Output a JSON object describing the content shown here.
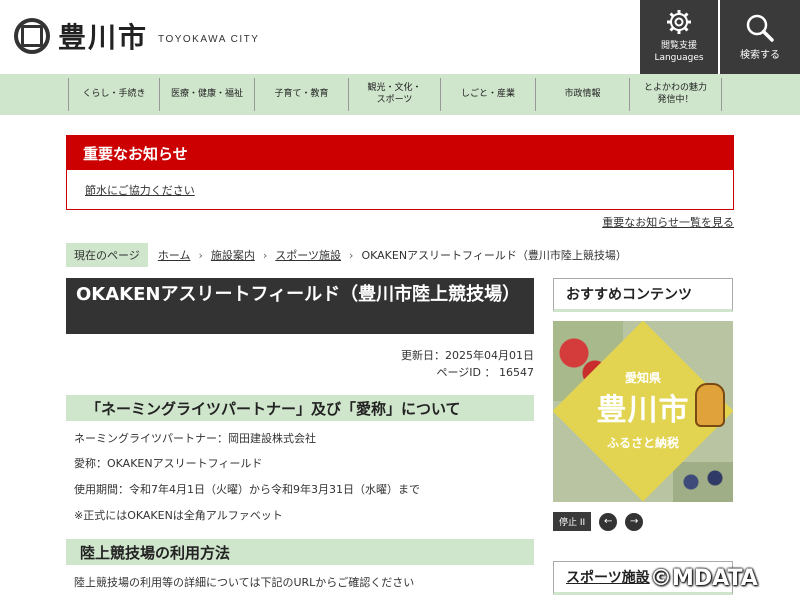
{
  "header": {
    "logo_jp": "豊川市",
    "logo_en": "TOYOKAWA CITY",
    "support_label_1": "閲覧支援",
    "support_label_2": "Languages",
    "search_label": "検索する"
  },
  "nav": {
    "items": [
      {
        "label": "くらし・手続き"
      },
      {
        "label": "医療・健康・福祉"
      },
      {
        "label": "子育て・教育"
      },
      {
        "label_1": "観光・文化・",
        "label_2": "スポーツ"
      },
      {
        "label": "しごと・産業"
      },
      {
        "label": "市政情報"
      },
      {
        "label_1": "とよかわの魅力",
        "label_2": "発信中！"
      }
    ]
  },
  "notice": {
    "heading": "重要なお知らせ",
    "link": "節水にご協力ください",
    "all_link": "重要なお知らせ一覧を見る"
  },
  "breadcrumb": {
    "label": "現在のページ",
    "items": [
      "ホーム",
      "施設案内",
      "スポーツ施設",
      "OKAKENアスリートフィールド（豊川市陸上競技場）"
    ]
  },
  "main": {
    "title": "OKAKENアスリートフィールド（豊川市陸上競技場）",
    "updated": "更新日：2025年04月01日",
    "page_id": "ページID ： 16547",
    "section1": {
      "heading": "「ネーミングライツパートナー」及び「愛称」について",
      "lines": [
        "ネーミングライツパートナー：岡田建設株式会社",
        "愛称：OKAKENアスリートフィールド",
        "使用期間：令和7年4月1日（火曜）から令和9年3月31日（水曜）まで",
        "※正式にはOKAKENは全角アルファベット"
      ]
    },
    "section2": {
      "heading": "陸上競技場の利用方法",
      "line": "陸上競技場の利用等の詳細については下記のURLからご確認ください"
    }
  },
  "sidebar": {
    "recommended": "おすすめコンテンツ",
    "banner": {
      "pref": "愛知県",
      "city": "豊川市",
      "tax": "ふるさと納税"
    },
    "stop_label": "停止 II",
    "prev": "←",
    "next": "→",
    "sports": "スポーツ施設"
  },
  "watermark": "©MDATA"
}
